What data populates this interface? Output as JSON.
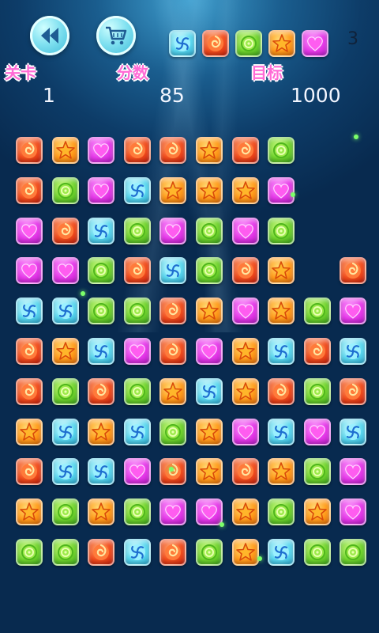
{
  "hud": {
    "level_label": "关卡",
    "score_label": "分数",
    "target_label": "目标",
    "level": "1",
    "score": "85",
    "target_score": "1000",
    "target_remaining": "3",
    "target_gems": [
      "cyan",
      "red",
      "green",
      "orange",
      "purple"
    ]
  },
  "buttons": {
    "back_icon": "rewind-icon",
    "shop_icon": "cart-icon"
  },
  "colors": {
    "label": "#ff6ad5",
    "value": "#f3f6ff",
    "background_top": "#3f9fcf",
    "background_bottom": "#082a4f"
  },
  "board": {
    "columns": 10,
    "rows": 11,
    "grid": [
      [
        "red",
        "orange",
        "purple",
        "red",
        "red",
        "orange",
        "red",
        "green",
        null,
        null
      ],
      [
        "red",
        "green",
        "purple",
        "cyan",
        "orange",
        "orange",
        "orange",
        "purple",
        null,
        null
      ],
      [
        "purple",
        "red",
        "cyan",
        "green",
        "purple",
        "green",
        "purple",
        "green",
        null,
        null
      ],
      [
        "purple",
        "purple",
        "green",
        "red",
        "cyan",
        "green",
        "red",
        "orange",
        null,
        "red"
      ],
      [
        "cyan",
        "cyan",
        "green",
        "green",
        "red",
        "orange",
        "purple",
        "orange",
        "green",
        "purple"
      ],
      [
        "red",
        "orange",
        "cyan",
        "purple",
        "red",
        "purple",
        "orange",
        "cyan",
        "red",
        "cyan"
      ],
      [
        "red",
        "green",
        "red",
        "green",
        "orange",
        "cyan",
        "orange",
        "red",
        "green",
        "red"
      ],
      [
        "orange",
        "cyan",
        "orange",
        "cyan",
        "green",
        "orange",
        "purple",
        "cyan",
        "purple",
        "cyan"
      ],
      [
        "red",
        "cyan",
        "cyan",
        "purple",
        "red",
        "orange",
        "red",
        "orange",
        "green",
        "purple"
      ],
      [
        "orange",
        "green",
        "orange",
        "green",
        "purple",
        "purple",
        "orange",
        "green",
        "orange",
        "purple"
      ],
      [
        "green",
        "green",
        "red",
        "cyan",
        "red",
        "green",
        "orange",
        "cyan",
        "green",
        "green"
      ]
    ]
  }
}
